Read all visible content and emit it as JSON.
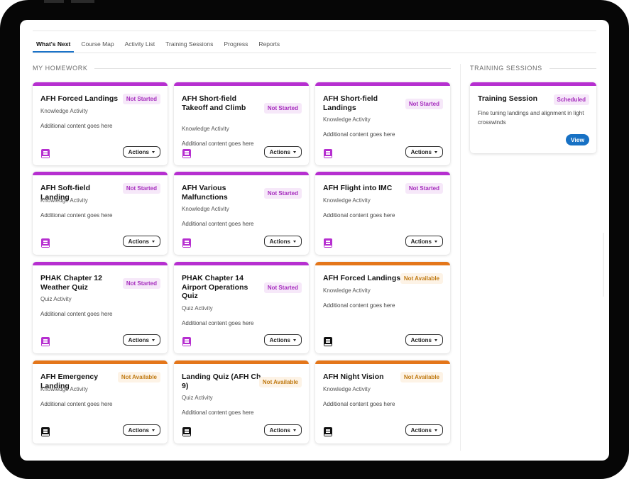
{
  "tabs": [
    {
      "label": "What's Next",
      "active": true
    },
    {
      "label": "Course Map"
    },
    {
      "label": "Activity List"
    },
    {
      "label": "Training Sessions"
    },
    {
      "label": "Progress"
    },
    {
      "label": "Reports"
    }
  ],
  "homework": {
    "heading": "MY HOMEWORK",
    "cards": [
      {
        "title": "AFH Forced Landings",
        "status": "Not Started",
        "type": "Knowledge Activity",
        "extra": "Additional content goes here",
        "action": "Actions",
        "color": "purple",
        "icon": "book-icon"
      },
      {
        "title": "AFH Short-field Takeoff and Climb",
        "status": "Not Started",
        "type": "Knowledge Activity",
        "extra": "Additional content goes here",
        "action": "Actions",
        "color": "purple",
        "icon": "book-icon"
      },
      {
        "title": "AFH Short-field Landings",
        "status": "Not Started",
        "type": "Knowledge Activity",
        "extra": "Additional content goes here",
        "action": "Actions",
        "color": "purple",
        "icon": "book-icon"
      },
      {
        "title": "AFH Soft-field Landing",
        "status": "Not Started",
        "type": "Knowledge Activity",
        "extra": "Additional content goes here",
        "action": "Actions",
        "color": "purple",
        "icon": "book-icon"
      },
      {
        "title": "AFH Various Malfunctions",
        "status": "Not Started",
        "type": "Knowledge Activity",
        "extra": "Additional content goes here",
        "action": "Actions",
        "color": "purple",
        "icon": "book-icon"
      },
      {
        "title": "AFH Flight into IMC",
        "status": "Not Started",
        "type": "Knowledge Activity",
        "extra": "Additional content goes here",
        "action": "Actions",
        "color": "purple",
        "icon": "book-icon"
      },
      {
        "title": "PHAK Chapter 12 Weather Quiz",
        "status": "Not Started",
        "type": "Quiz Activity",
        "extra": "Additional content goes here",
        "action": "Actions",
        "color": "purple",
        "icon": "book-icon"
      },
      {
        "title": "PHAK Chapter 14 Airport Operations Quiz",
        "status": "Not Started",
        "type": "Quiz Activity",
        "extra": "Additional content goes here",
        "action": "Actions",
        "color": "purple",
        "icon": "book-icon"
      },
      {
        "title": "AFH Forced Landings",
        "status": "Not Available",
        "type": "Knowledge Activity",
        "extra": "Additional content goes here",
        "action": "Actions",
        "color": "orange",
        "icon": "book-icon"
      },
      {
        "title": "AFH Emergency Landing",
        "status": "Not Available",
        "type": "Knowledge Activity",
        "extra": "Additional content goes here",
        "action": "Actions",
        "color": "orange",
        "icon": "book-icon"
      },
      {
        "title": "Landing Quiz (AFH Ch 9)",
        "status": "Not Available",
        "type": "Quiz Activity",
        "extra": "Additional content goes here",
        "action": "Actions",
        "color": "orange",
        "icon": "book-icon"
      },
      {
        "title": "AFH Night Vision",
        "status": "Not Available",
        "type": "Knowledge Activity",
        "extra": "Additional content goes here",
        "action": "Actions",
        "color": "orange",
        "icon": "book-icon"
      }
    ]
  },
  "training": {
    "heading": "TRAINING SESSIONS",
    "session": {
      "title": "Training Session",
      "status": "Scheduled",
      "description": "Fine tuning landings and alignment in light crosswinds",
      "action": "View"
    }
  },
  "colors": {
    "purple": "#b62fd0",
    "orange": "#e4761a",
    "blue": "#1771c4"
  }
}
